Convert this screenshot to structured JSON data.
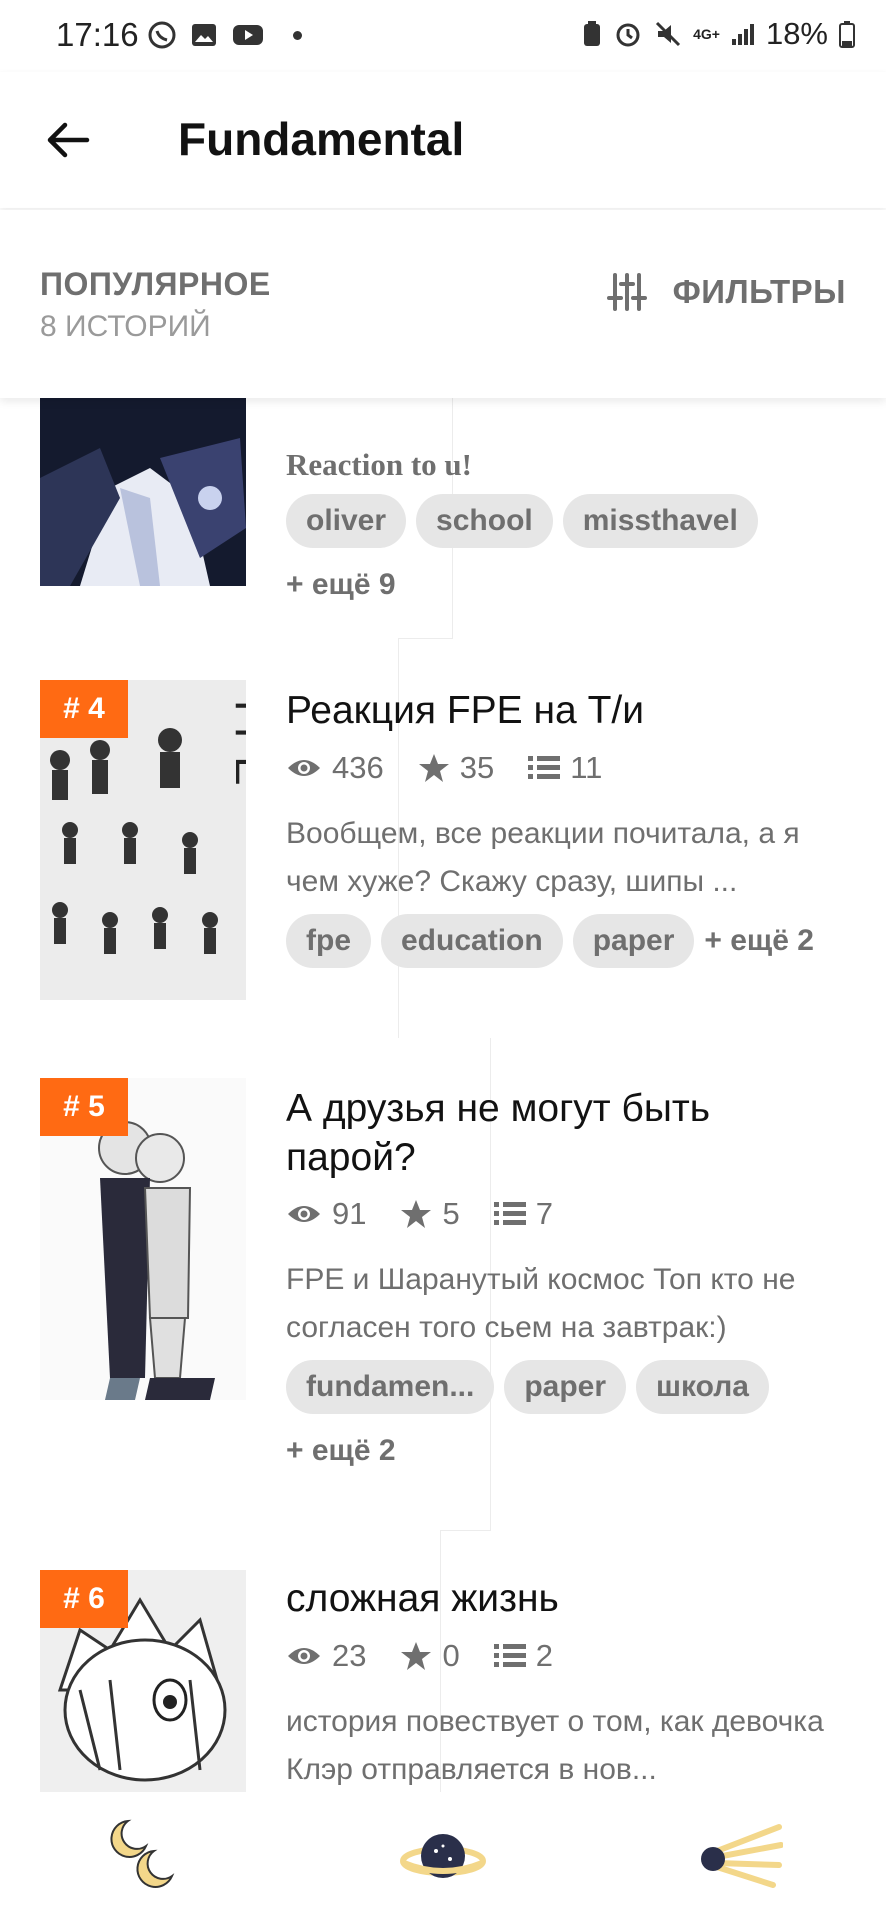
{
  "status_bar": {
    "time": "17:16",
    "network": "4G+",
    "battery": "18%"
  },
  "toolbar": {
    "title": "Fundamental"
  },
  "sort": {
    "label": "ПОПУЛЯРНОЕ",
    "count": "8 ИСТОРИЙ",
    "filters_label": "ФИЛЬТРЫ"
  },
  "stories": [
    {
      "title": "Reaction to u!",
      "tags": [
        "oliver",
        "school",
        "missthavel"
      ],
      "more": "+ ещё 9"
    },
    {
      "rank": "# 4",
      "title": "Реакция FPE на Т/и",
      "views": "436",
      "votes": "35",
      "parts": "11",
      "description": "Вообщем, все реакции почитала, а я чем хуже? Скажу сразу, шипы ...",
      "tags": [
        "fpe",
        "education",
        "paper"
      ],
      "more": "+ ещё 2"
    },
    {
      "rank": "# 5",
      "title": "А друзья не могут быть парой?",
      "views": "91",
      "votes": "5",
      "parts": "7",
      "description": "FPE и Шаранутый космос Топ кто не согласен того сьем на завтрак:)",
      "tags": [
        "fundamen...",
        "paper",
        "школа"
      ],
      "more": "+ ещё 2"
    },
    {
      "rank": "# 6",
      "title": "сложная жизнь",
      "views": "23",
      "votes": "0",
      "parts": "2",
      "description": "история повествует о том, как девочка Клэр отправляется в нов..."
    }
  ],
  "bottom_nav": {
    "items": [
      "moons-icon",
      "planet-icon",
      "comet-icon"
    ],
    "accent": "#f3d78a"
  },
  "colors": {
    "rank_badge": "#ff6a13",
    "tag_bg": "#e6e6e6"
  }
}
